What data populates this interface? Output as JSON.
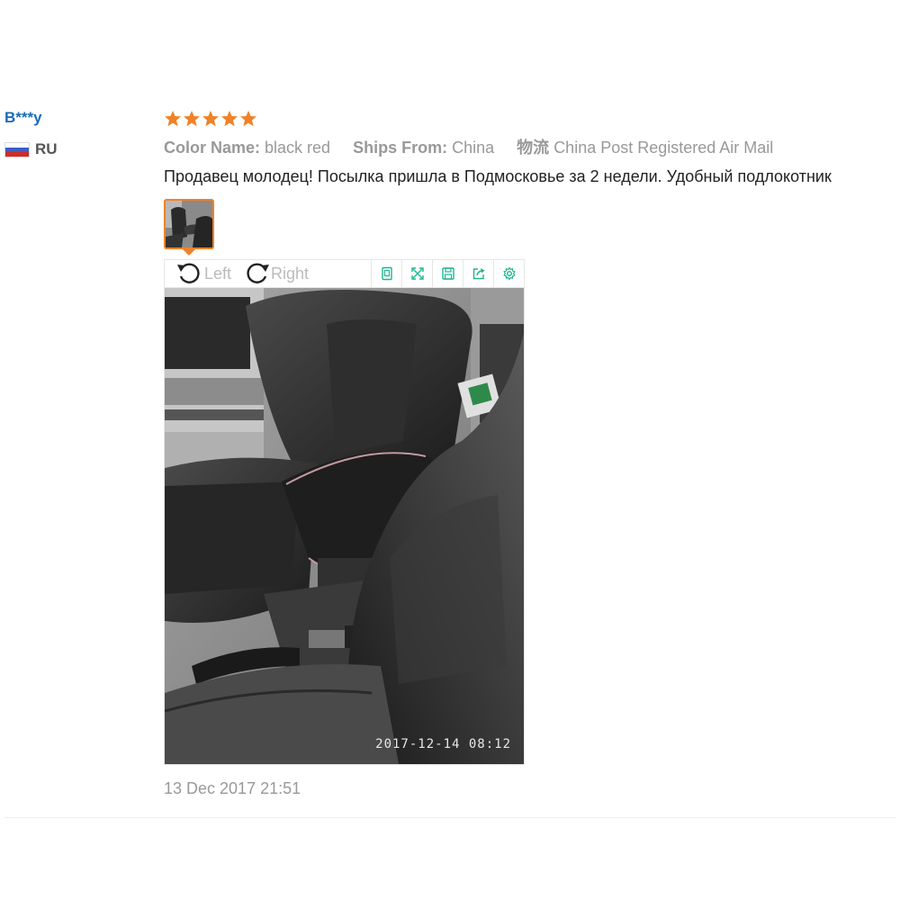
{
  "user": {
    "name": "B***y",
    "country": "RU",
    "flag_colors": [
      "#ffffff",
      "#3a5fc8",
      "#d52b1e"
    ]
  },
  "review": {
    "rating": 5,
    "rating_max": 5,
    "star_color": "#f08228",
    "color_name_label": "Color Name:",
    "color_name_value": "black red",
    "ships_from_label": "Ships From:",
    "ships_from_value": "China",
    "logistics_label": "物流",
    "logistics_value": "China Post Registered Air Mail",
    "text": "Продавец молодец! Посылка пришла в Подмосковье за 2 недели. Удобный подлокотник",
    "date": "13 Dec 2017 21:51"
  },
  "viewer": {
    "rotate_left_label": "Left",
    "rotate_right_label": "Right",
    "tools": [
      "original-size-icon",
      "fullscreen-icon",
      "save-icon",
      "share-icon",
      "settings-icon"
    ],
    "tool_color": "#1fb58f",
    "photo_timestamp": "2017-12-14 08:12"
  }
}
